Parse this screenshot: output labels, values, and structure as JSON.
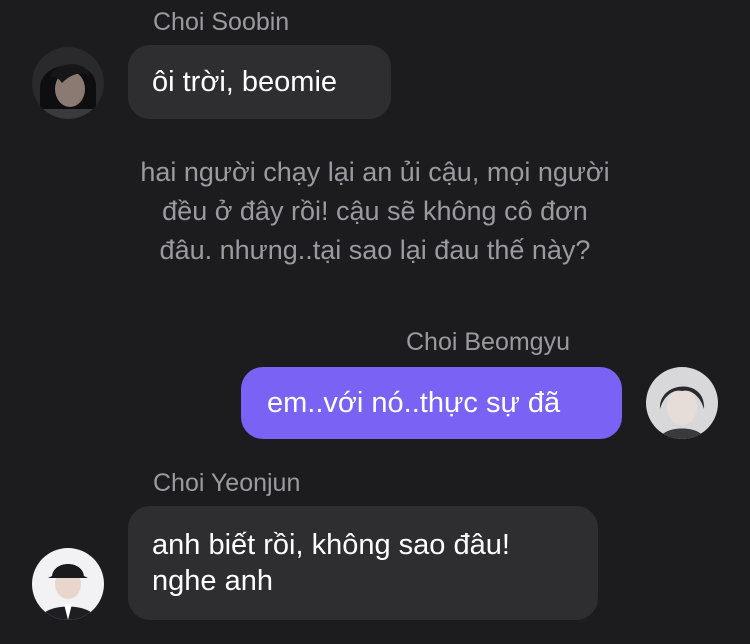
{
  "messages": [
    {
      "sender": "Choi Soobin",
      "text": "ôi trời, beomie",
      "direction": "incoming",
      "avatar_icon": "profile-photo-dark-hair"
    },
    {
      "sender": "Choi Beomgyu",
      "text": "em..với nó..thực sự đã",
      "direction": "outgoing",
      "avatar_icon": "profile-photo-light"
    },
    {
      "sender": "Choi Yeonjun",
      "lines": [
        "anh biết rồi, không sao đâu!",
        "nghe anh"
      ],
      "direction": "incoming",
      "avatar_icon": "profile-photo-cap"
    }
  ],
  "narration": {
    "lines": [
      "hai người chạy lại an ủi cậu, mọi người",
      "đều ở đây rồi! cậu sẽ không cô đơn",
      "đâu. nhưng..tại sao lại đau thế này?"
    ]
  },
  "colors": {
    "background": "#1c1c1e",
    "incoming_bubble": "#2e2e30",
    "outgoing_bubble": "#7a62f5",
    "secondary_text": "#9a9aa0",
    "message_text": "#ffffff"
  }
}
